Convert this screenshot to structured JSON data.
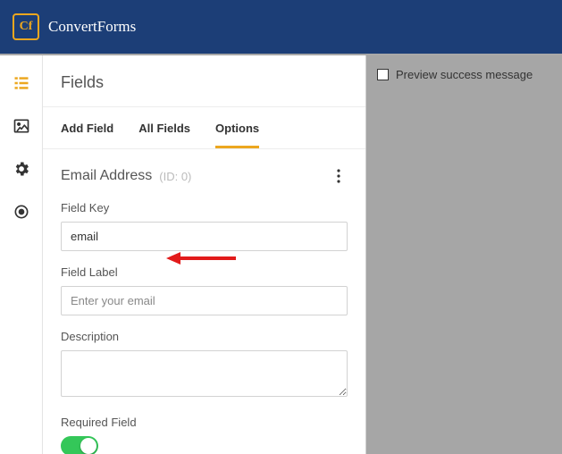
{
  "brand": {
    "logoText": "Cf",
    "name": "ConvertForms"
  },
  "sidenav": {
    "items": [
      {
        "name": "fields",
        "active": true
      },
      {
        "name": "image",
        "active": false
      },
      {
        "name": "settings",
        "active": false
      },
      {
        "name": "target",
        "active": false
      }
    ]
  },
  "panel": {
    "title": "Fields",
    "tabs": {
      "addField": "Add Field",
      "allFields": "All Fields",
      "options": "Options",
      "active": "options"
    },
    "currentField": {
      "title": "Email Address",
      "idLabel": "(ID: 0)"
    },
    "form": {
      "fieldKey": {
        "label": "Field Key",
        "value": "email"
      },
      "fieldLabel": {
        "label": "Field Label",
        "placeholder": "Enter your email",
        "value": ""
      },
      "description": {
        "label": "Description",
        "value": ""
      },
      "required": {
        "label": "Required Field",
        "on": true
      }
    }
  },
  "preview": {
    "checkboxLabel": "Preview success message"
  }
}
